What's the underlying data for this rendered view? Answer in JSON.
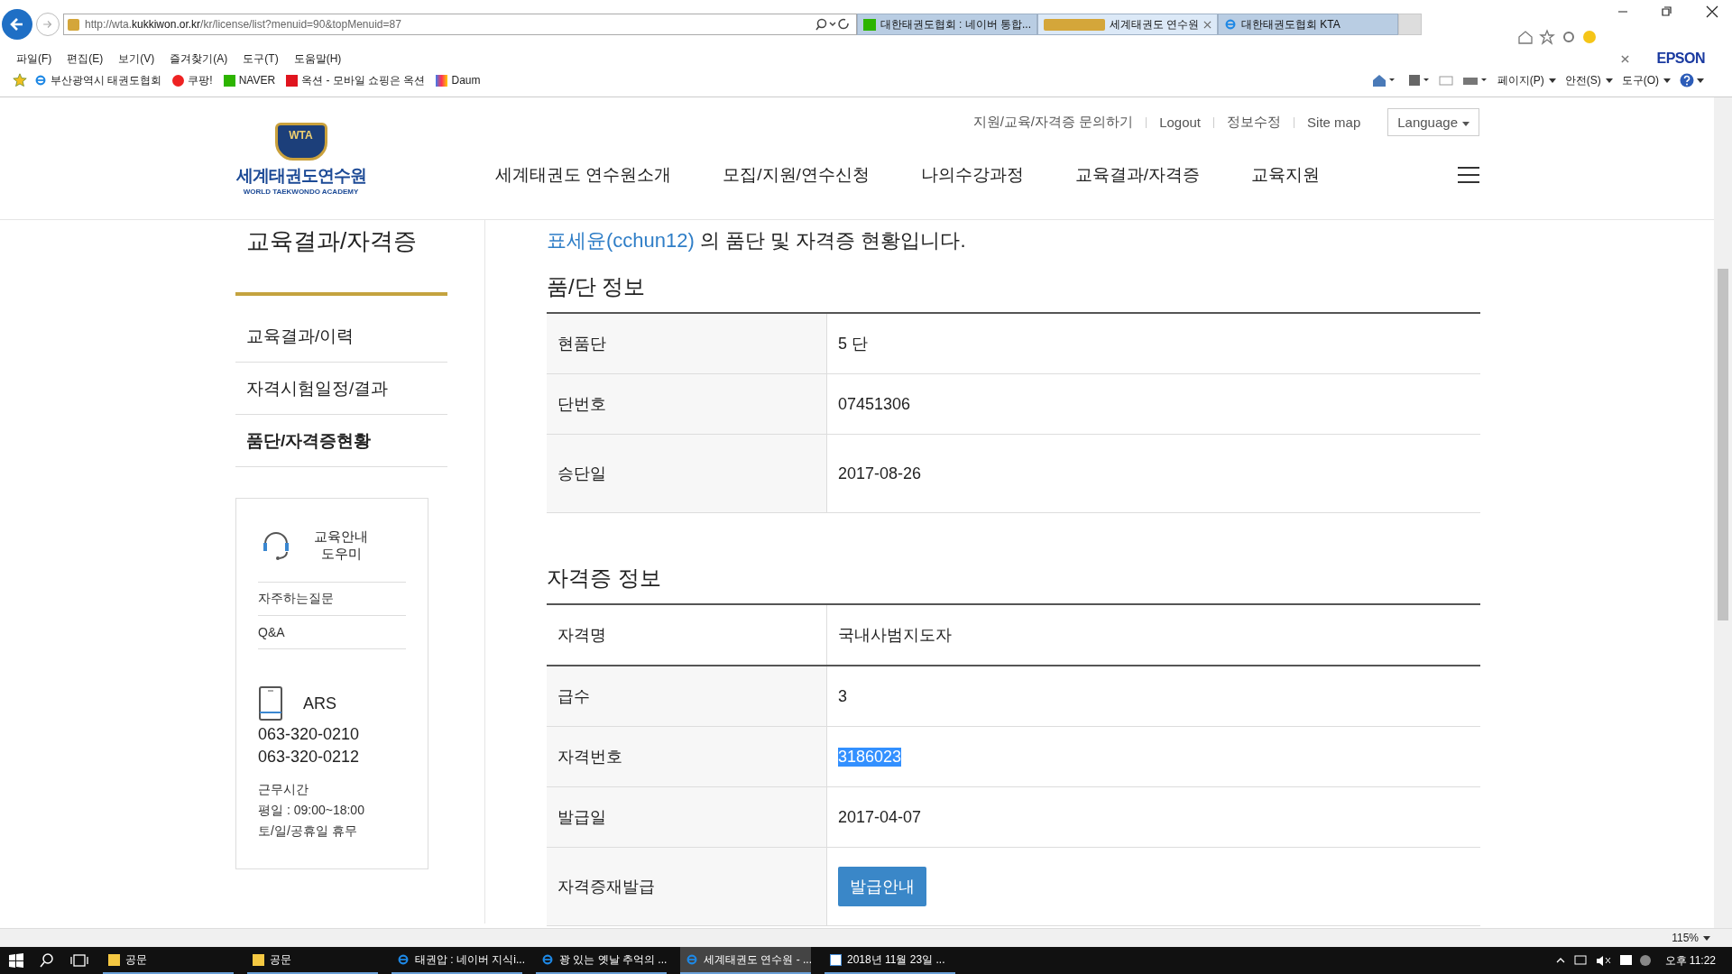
{
  "browser": {
    "url_plain": "http://wta.",
    "url_domain": "kukkiwon.or.kr",
    "url_path": "/kr/license/list?menuid=90&topMenuid=87",
    "tabs": [
      {
        "title": "대한태권도협회 : 네이버 통합...",
        "kind": "naver",
        "selected": false
      },
      {
        "title": "세계태권도 연수원",
        "kind": "wta",
        "selected": true
      },
      {
        "title": "대한태권도협회 KTA",
        "kind": "ie",
        "selected": false
      }
    ],
    "menu": [
      "파일(F)",
      "편집(E)",
      "보기(V)",
      "즐겨찾기(A)",
      "도구(T)",
      "도움말(H)"
    ],
    "favorites": [
      {
        "label": "부산광역시 태권도협회",
        "kind": "ie"
      },
      {
        "label": "쿠팡!",
        "kind": "coupang"
      },
      {
        "label": "NAVER",
        "kind": "naver"
      },
      {
        "label": "옥션 - 모바일 쇼핑은 옥션",
        "kind": "auction"
      },
      {
        "label": "Daum",
        "kind": "daum"
      }
    ],
    "toolbar_brand": "EPSON",
    "commands": [
      "페이지(P)",
      "안전(S)",
      "도구(O)"
    ]
  },
  "site": {
    "logo": {
      "badge": "WTA",
      "name": "세계태권도연수원",
      "subtitle": "WORLD TAEKWONDO ACADEMY"
    },
    "util_links": [
      "지원/교육/자격증 문의하기",
      "Logout",
      "정보수정",
      "Site map"
    ],
    "language": "Language",
    "nav": [
      "세계태권도 연수원소개",
      "모집/지원/연수신청",
      "나의수강과정",
      "교육결과/자격증",
      "교육지원"
    ]
  },
  "sidebar": {
    "title": "교육결과/자격증",
    "items": [
      {
        "label": "교육결과/이력",
        "selected": false
      },
      {
        "label": "자격시험일정/결과",
        "selected": false
      },
      {
        "label": "품단/자격증현황",
        "selected": true
      }
    ],
    "help": {
      "title": "교육안내\n도우미",
      "links": [
        "자주하는질문",
        "Q&A"
      ],
      "ars": "ARS",
      "phones": [
        "063-320-0210",
        "063-320-0212"
      ],
      "hours": [
        "근무시간",
        "평일 : 09:00~18:00",
        "토/일/공휴일 휴무"
      ]
    }
  },
  "main": {
    "user_link": "표세윤(cchun12)",
    "intro_rest": " 의 품단 및 자격증 현황입니다.",
    "sections": [
      {
        "title": "품/단 정보",
        "rows": [
          {
            "label": "현품단",
            "value": "5 단",
            "kind": "text"
          },
          {
            "label": "단번호",
            "value": "07451306",
            "kind": "text"
          },
          {
            "label": "승단일",
            "value": "2017-08-26",
            "kind": "text"
          }
        ]
      },
      {
        "title": "자격증 정보",
        "header": {
          "label": "자격명",
          "value": "국내사범지도자"
        },
        "rows": [
          {
            "label": "급수",
            "value": "3",
            "kind": "text"
          },
          {
            "label": "자격번호",
            "value": "3186023",
            "kind": "text",
            "highlighted": true
          },
          {
            "label": "발급일",
            "value": "2017-04-07",
            "kind": "text"
          },
          {
            "label": "자격증재발급",
            "value": "발급안내",
            "kind": "button"
          }
        ]
      }
    ]
  },
  "status_bar": {
    "zoom": "115%"
  },
  "taskbar": {
    "items": [
      {
        "label": "공문",
        "kind": "folder",
        "selected": false
      },
      {
        "label": "공문",
        "kind": "folder",
        "selected": false
      },
      {
        "label": "태권압 : 네이버 지식i...",
        "kind": "ie",
        "selected": false
      },
      {
        "label": "꽝 있는 옛날 추억의 ...",
        "kind": "ie",
        "selected": false
      },
      {
        "label": "세계태권도 연수원 - ...",
        "kind": "ie",
        "selected": true
      },
      {
        "label": "2018년 11월 23일 ...",
        "kind": "doc",
        "selected": false
      }
    ],
    "clock": "오후 11:22"
  }
}
